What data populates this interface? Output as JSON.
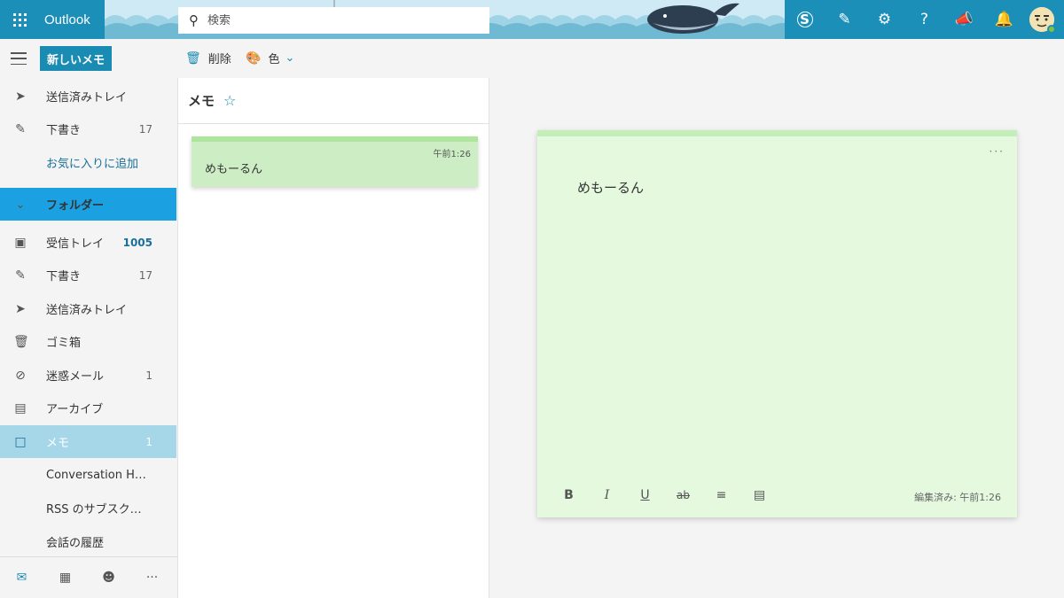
{
  "header": {
    "app_name": "Outlook",
    "search_placeholder": "検索",
    "icons": [
      "skype-icon",
      "compose-icon",
      "gear-icon",
      "help-icon",
      "megaphone-icon",
      "bell-icon",
      "avatar"
    ]
  },
  "toolbar": {
    "new_label": "新しいメモ",
    "delete_label": "削除",
    "color_label": "色"
  },
  "sidebar": {
    "favorites": [
      {
        "label": "送信済みトレイ",
        "icon": "send-icon",
        "count": ""
      },
      {
        "label": "下書き",
        "icon": "pencil-icon",
        "count": "17"
      }
    ],
    "add_favorite_label": "お気に入りに追加",
    "folders_header": "フォルダー",
    "folders": [
      {
        "label": "受信トレイ",
        "icon": "inbox-icon",
        "count": "1005"
      },
      {
        "label": "下書き",
        "icon": "pencil-icon",
        "count": "17"
      },
      {
        "label": "送信済みトレイ",
        "icon": "send-icon",
        "count": ""
      },
      {
        "label": "ゴミ箱",
        "icon": "trash-icon",
        "count": ""
      },
      {
        "label": "迷惑メール",
        "icon": "block-icon",
        "count": "1"
      },
      {
        "label": "アーカイブ",
        "icon": "archive-icon",
        "count": ""
      },
      {
        "label": "メモ",
        "icon": "note-icon",
        "count": "1"
      },
      {
        "label": "Conversation Hist...",
        "icon": "",
        "count": ""
      },
      {
        "label": "RSS のサブスクリプシ...",
        "icon": "",
        "count": ""
      },
      {
        "label": "会話の履歴",
        "icon": "",
        "count": ""
      }
    ],
    "bottom_nav": [
      "mail-icon",
      "calendar-icon",
      "people-icon",
      "more-icon"
    ]
  },
  "notes": {
    "title": "メモ",
    "items": [
      {
        "text": "めもーるん",
        "time": "午前1:26"
      }
    ]
  },
  "editor": {
    "content": "めもーるん",
    "format_buttons": [
      "B",
      "I",
      "U",
      "ab"
    ],
    "edited_label": "編集済み: 午前1:26"
  },
  "colors": {
    "brand": "#1b8fb8",
    "accent": "#1a8bb3",
    "active_nav": "#a6d7e8",
    "note_bg": "#e4f9de",
    "note_card": "#cdeec4"
  }
}
